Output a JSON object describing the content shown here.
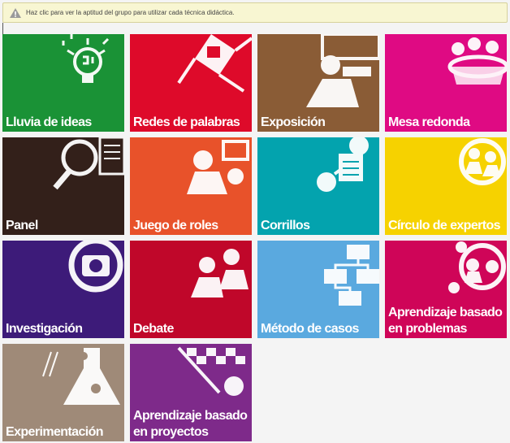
{
  "notice": {
    "icon": "warning-icon",
    "text": "Haz clic para ver la aptitud del grupo para utilizar cada técnica didáctica."
  },
  "tiles": [
    {
      "label": "Lluvia de ideas",
      "color": "#1a9236",
      "icon": "lightbulb-icon"
    },
    {
      "label": "Redes de palabras",
      "color": "#de0a2a",
      "icon": "word-network-icon"
    },
    {
      "label": "Exposición",
      "color": "#8a5c36",
      "icon": "presenter-icon"
    },
    {
      "label": "Mesa redonda",
      "color": "#df0a83",
      "icon": "round-table-icon"
    },
    {
      "label": "Panel",
      "color": "#33201a",
      "icon": "magnifier-document-icon"
    },
    {
      "label": "Juego de roles",
      "color": "#e8522a",
      "icon": "role-play-icon"
    },
    {
      "label": "Corrillos",
      "color": "#03a3ae",
      "icon": "small-groups-icon"
    },
    {
      "label": "Círculo de expertos",
      "color": "#f6d200",
      "icon": "expert-circle-icon"
    },
    {
      "label": "Investigación",
      "color": "#3d1b79",
      "icon": "camera-icon"
    },
    {
      "label": "Debate",
      "color": "#c0072a",
      "icon": "debate-icon"
    },
    {
      "label": "Método de casos",
      "color": "#5aa9df",
      "icon": "case-diagram-icon"
    },
    {
      "label": "Aprendizaje basado\nen problemas",
      "color": "#cf0558",
      "icon": "problem-network-icon"
    },
    {
      "label": "Experimentación",
      "color": "#9f8a78",
      "icon": "flask-icon"
    },
    {
      "label": "Aprendizaje basado\nen proyectos",
      "color": "#7e2a8a",
      "icon": "project-flag-icon"
    }
  ]
}
